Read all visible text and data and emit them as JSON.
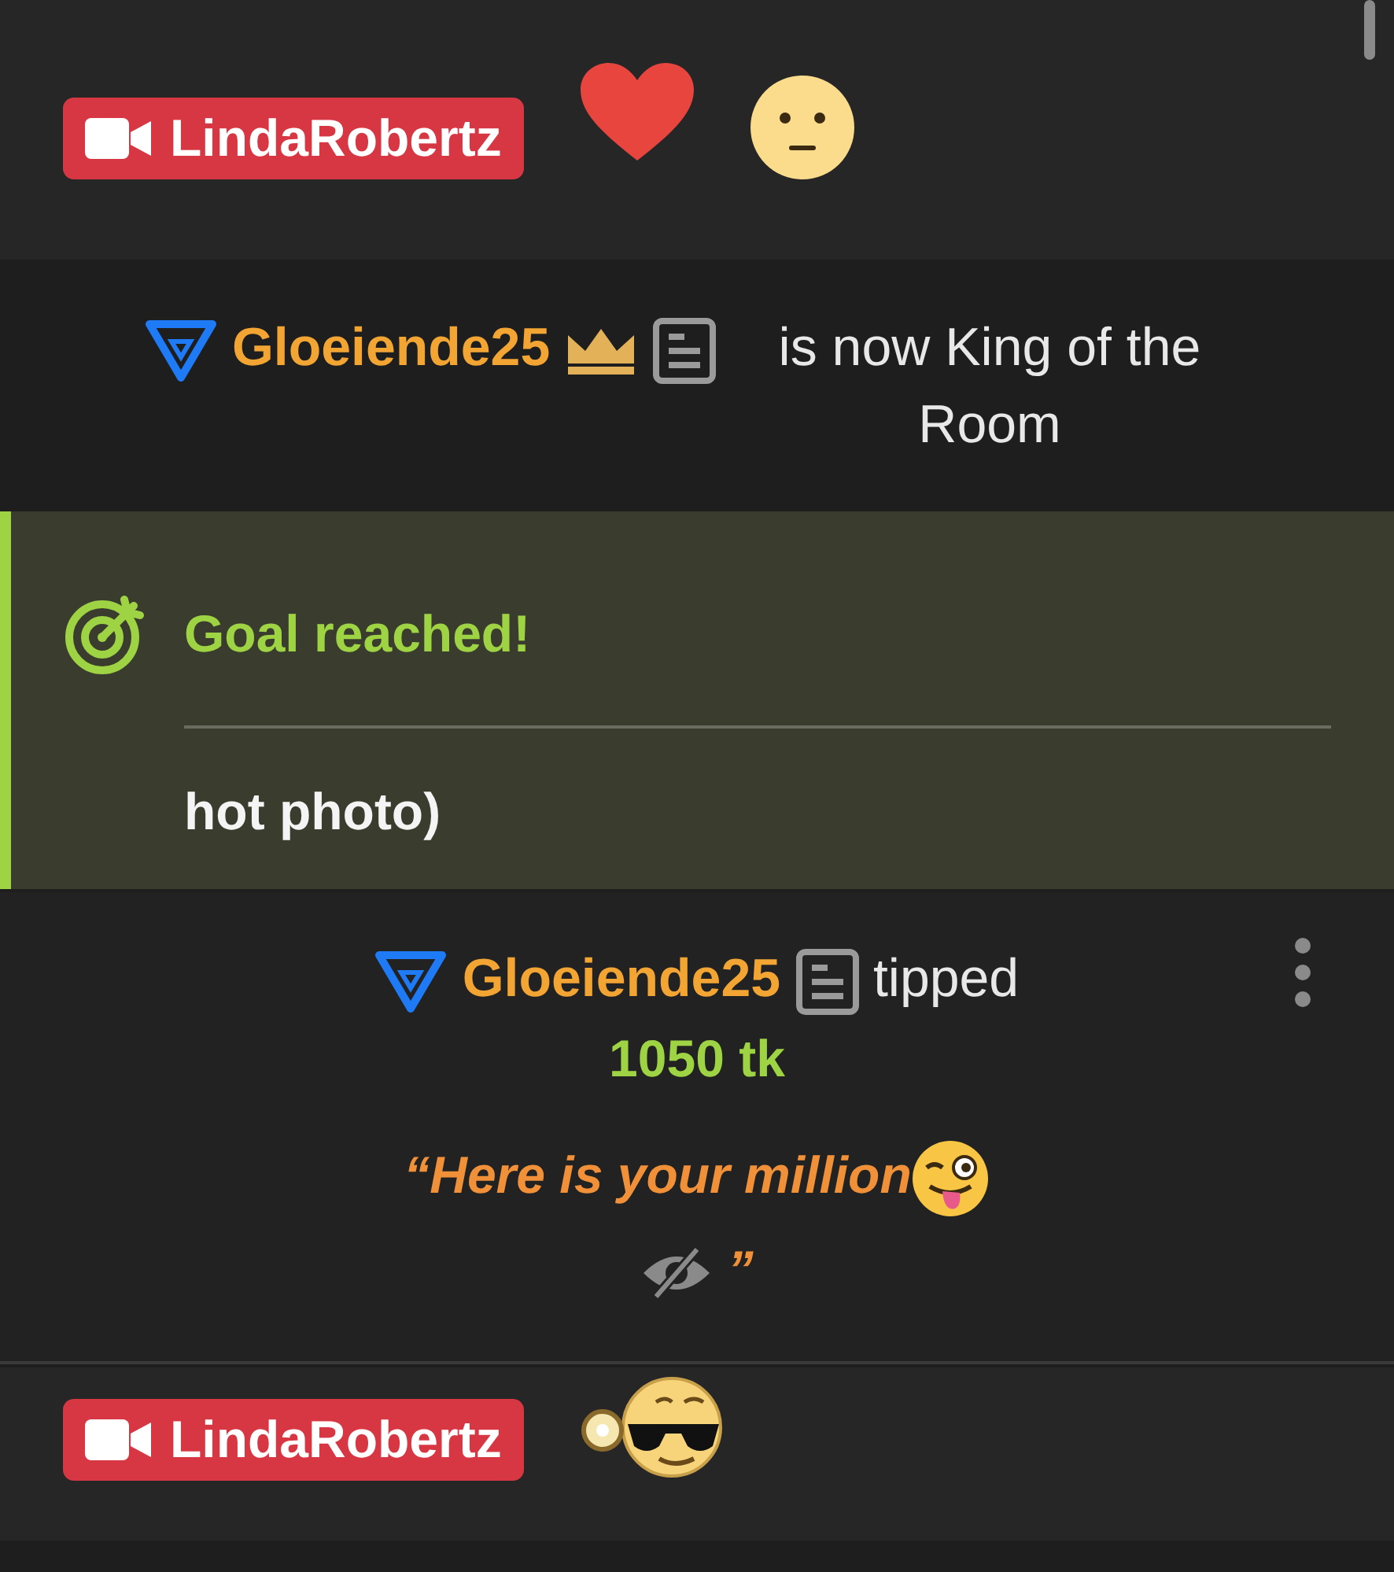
{
  "messages": [
    {
      "kind": "broadcaster",
      "name": "LindaRobertz",
      "reactions": [
        {
          "kind": "heart"
        },
        {
          "kind": "neutral-face"
        }
      ]
    },
    {
      "kind": "king",
      "user": "Gloeiende25",
      "text": "is now King of the Room"
    },
    {
      "kind": "goal",
      "title": "Goal reached!",
      "text": "hot photo)"
    },
    {
      "kind": "tip",
      "user": "Gloeiende25",
      "action": "tipped",
      "amount": "1050 tk",
      "open_quote": "“Here is your million",
      "close_quote": "”"
    },
    {
      "kind": "broadcaster",
      "name": "LindaRobertz",
      "reactions": [
        {
          "kind": "sunglasses-face"
        }
      ]
    }
  ]
}
